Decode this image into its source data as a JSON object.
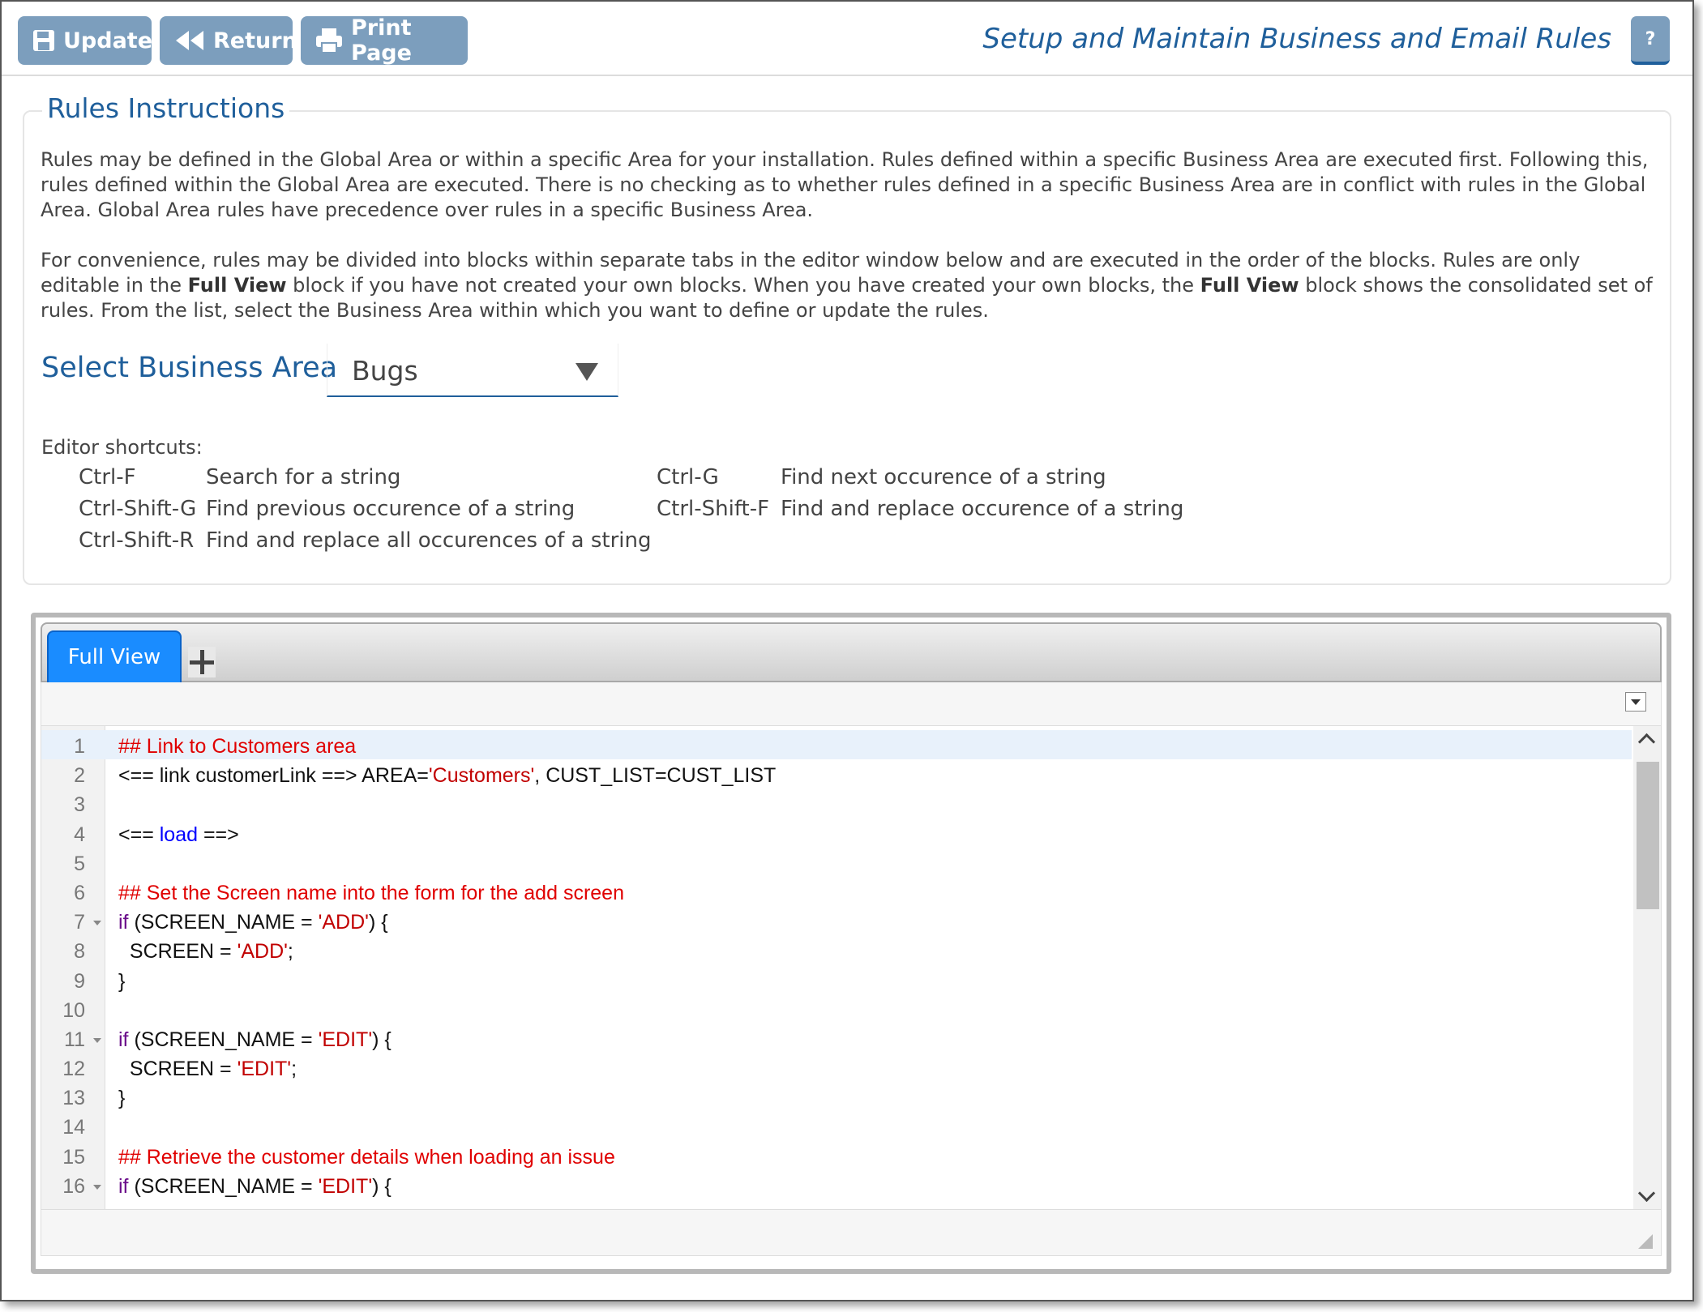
{
  "toolbar": {
    "update_label": "Update",
    "return_label": "Return",
    "print_label": "Print Page",
    "page_title": "Setup and Maintain Business and Email Rules",
    "help_label": "?"
  },
  "instructions": {
    "legend": "Rules Instructions",
    "paragraph1": "Rules may be defined in the Global Area or within a specific Area for your installation. Rules defined within a specific Business Area are executed first. Following this, rules defined within the Global Area are executed. There is no checking as to whether rules defined in a specific Business Area are in conflict with rules in the Global Area. Global Area rules have precedence over rules in a specific Business Area.",
    "paragraph2_a": "For convenience, rules may be divided into blocks within separate tabs in the editor window below and are executed in the order of the blocks. Rules are only editable in the ",
    "paragraph2_b": "Full View",
    "paragraph2_c": " block if you have not created your own blocks. When you have created your own blocks, the ",
    "paragraph2_d": "Full View",
    "paragraph2_e": " block shows the consolidated set of rules. From the list, select the Business Area within which you want to define or update the rules.",
    "select_label": "Select Business Area",
    "select_value": "Bugs",
    "shortcuts_title": "Editor shortcuts:",
    "shortcuts": [
      {
        "key": "Ctrl-F",
        "desc": "Search for a string"
      },
      {
        "key": "Ctrl-G",
        "desc": "Find next occurence of a string"
      },
      {
        "key": "Ctrl-Shift-G",
        "desc": "Find previous occurence of a string"
      },
      {
        "key": "Ctrl-Shift-F",
        "desc": "Find and replace occurence of a string"
      },
      {
        "key": "Ctrl-Shift-R",
        "desc": "Find and replace all occurences of a string"
      }
    ]
  },
  "editor": {
    "tab_label": "Full View",
    "lines": [
      {
        "n": "1",
        "code": "## Link to Customers area"
      },
      {
        "n": "2",
        "code": "<== link customerLink ==> AREA='Customers', CUST_LIST=CUST_LIST"
      },
      {
        "n": "3",
        "code": ""
      },
      {
        "n": "4",
        "code": "<== load ==>"
      },
      {
        "n": "5",
        "code": ""
      },
      {
        "n": "6",
        "code": "## Set the Screen name into the form for the add screen"
      },
      {
        "n": "7",
        "code": "if (SCREEN_NAME = 'ADD') {"
      },
      {
        "n": "8",
        "code": "  SCREEN = 'ADD';"
      },
      {
        "n": "9",
        "code": "}"
      },
      {
        "n": "10",
        "code": ""
      },
      {
        "n": "11",
        "code": "if (SCREEN_NAME = 'EDIT') {"
      },
      {
        "n": "12",
        "code": "  SCREEN = 'EDIT';"
      },
      {
        "n": "13",
        "code": "}"
      },
      {
        "n": "14",
        "code": ""
      },
      {
        "n": "15",
        "code": "## Retrieve the customer details when loading an issue"
      },
      {
        "n": "16",
        "code": "if (SCREEN_NAME = 'EDIT') {"
      }
    ]
  }
}
